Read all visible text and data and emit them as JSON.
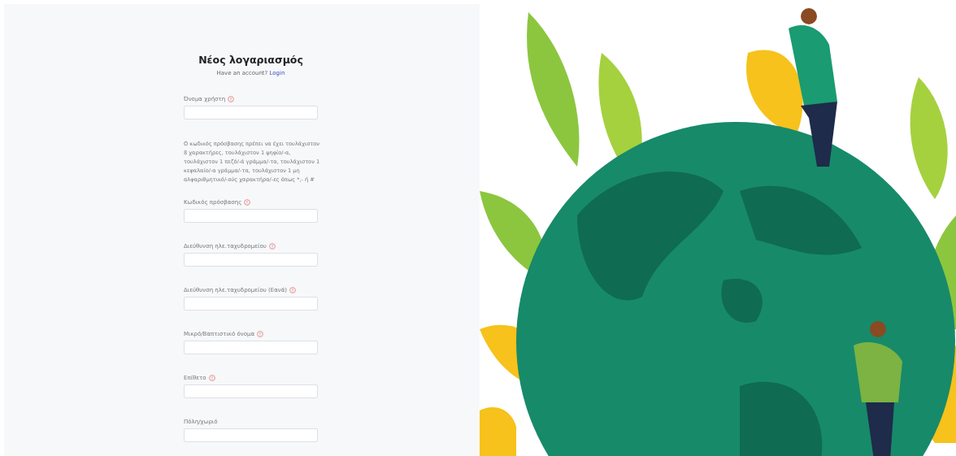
{
  "form": {
    "title": "Νέος λογαριασμός",
    "subtitle": "Have an account?",
    "login_link": "Login",
    "fields": [
      {
        "kind": "field",
        "label": "Όνομα χρήστη",
        "info_icon": true
      },
      {
        "kind": "hint",
        "text": "Ο κωδικός πρόσβασης πρέπει να έχει τουλάχιστον 8 χαρακτήρες, τουλάχιστον 1 ψηφίο/-α, τουλάχιστον 1 πεζό/-ά γράμμα/-τα, τουλάχιστον 1 κεφαλαίο/-α γράμμα/-τα, τουλάχιστον 1 μη αλφαριθμητικό/-ούς χαρακτήρα/-ες όπως *,- ή #"
      },
      {
        "kind": "field",
        "label": "Κωδικός πρόσβασης",
        "info_icon": true
      },
      {
        "kind": "field",
        "label": "Διεύθυνση ηλε.ταχυδρομείου",
        "info_icon": true
      },
      {
        "kind": "field",
        "label": "Διεύθυνση ηλε.ταχυδρομείου (Εανά)",
        "info_icon": true
      },
      {
        "kind": "field",
        "label": "Μικρό/Βαπτιστικό όνομα",
        "info_icon": true
      },
      {
        "kind": "field",
        "label": "Επίθετο",
        "info_icon": true
      },
      {
        "kind": "field",
        "label": "Πόλη/χωριό",
        "info_icon": false
      }
    ]
  }
}
